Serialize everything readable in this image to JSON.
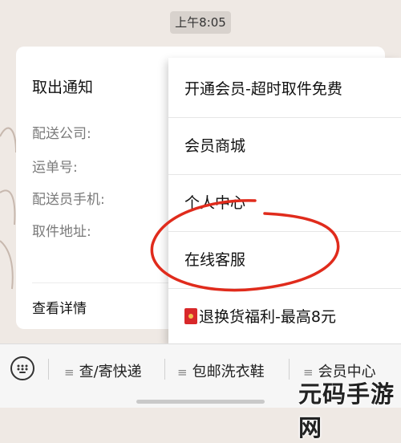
{
  "timestamp": "上午8:05",
  "card": {
    "title": "取出通知",
    "fields": [
      "配送公司:",
      "运单号:",
      "配送员手机:",
      "取件地址:"
    ],
    "details_link": "查看详情"
  },
  "menu": {
    "items": [
      "开通会员-超时取件免费",
      "会员商城",
      "个人中心",
      "在线客服",
      "退换货福利-最高8元"
    ],
    "highlight_color": "#e02b1c"
  },
  "bottom_bar": {
    "items": [
      "查/寄快递",
      "包邮洗衣鞋",
      "会员中心"
    ]
  },
  "watermark": "元码手游网"
}
